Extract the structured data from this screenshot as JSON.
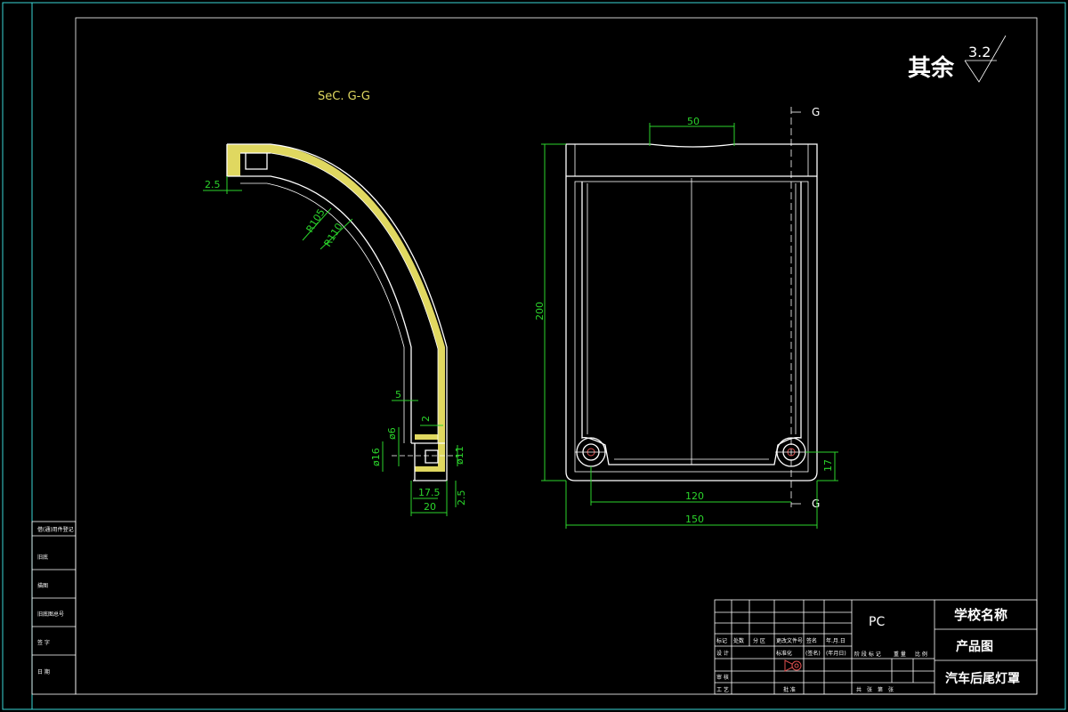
{
  "surface_finish": {
    "prefix": "其余",
    "value": "3.2"
  },
  "section_title": "SeC. G-G",
  "section_labels": {
    "top": "G",
    "bottom": "G"
  },
  "section_dims": {
    "d2_5_top": "2.5",
    "r105": "R105",
    "r110": "R110",
    "d5": "5",
    "d2": "2",
    "phi6": "ø6",
    "phi16": "ø16",
    "phi11": "ø11",
    "d17_5": "17.5",
    "d20": "20",
    "d2_5_bottom": "2.5"
  },
  "front_dims": {
    "d50": "50",
    "d200": "200",
    "d120": "120",
    "d150": "150",
    "d17": "17"
  },
  "left_strip": {
    "row1": "借(通)用件登记",
    "row2": "旧底",
    "row3": "描图",
    "row4": "旧底图总号",
    "row5": "签 字",
    "row6": "日 期"
  },
  "title_block": {
    "material": "PC",
    "school": "学校名称",
    "drawing_type": "产品图",
    "part_name": "汽车后尾灯罩",
    "hdr_mark": "标记",
    "hdr_count": "处数",
    "hdr_zone": "分 区",
    "hdr_doc": "更改文件号",
    "hdr_sign": "签名",
    "hdr_date": "年.月.日",
    "design": "设 计",
    "standard": "标准化",
    "sign2": "(签名)",
    "date2": "(年月日)",
    "review": "审 核",
    "process": "工 艺",
    "approve": "批 准",
    "stage": "阶 段 标 记",
    "weight": "重 量",
    "scale": "比 例",
    "sheets": "共　张　第　张"
  }
}
